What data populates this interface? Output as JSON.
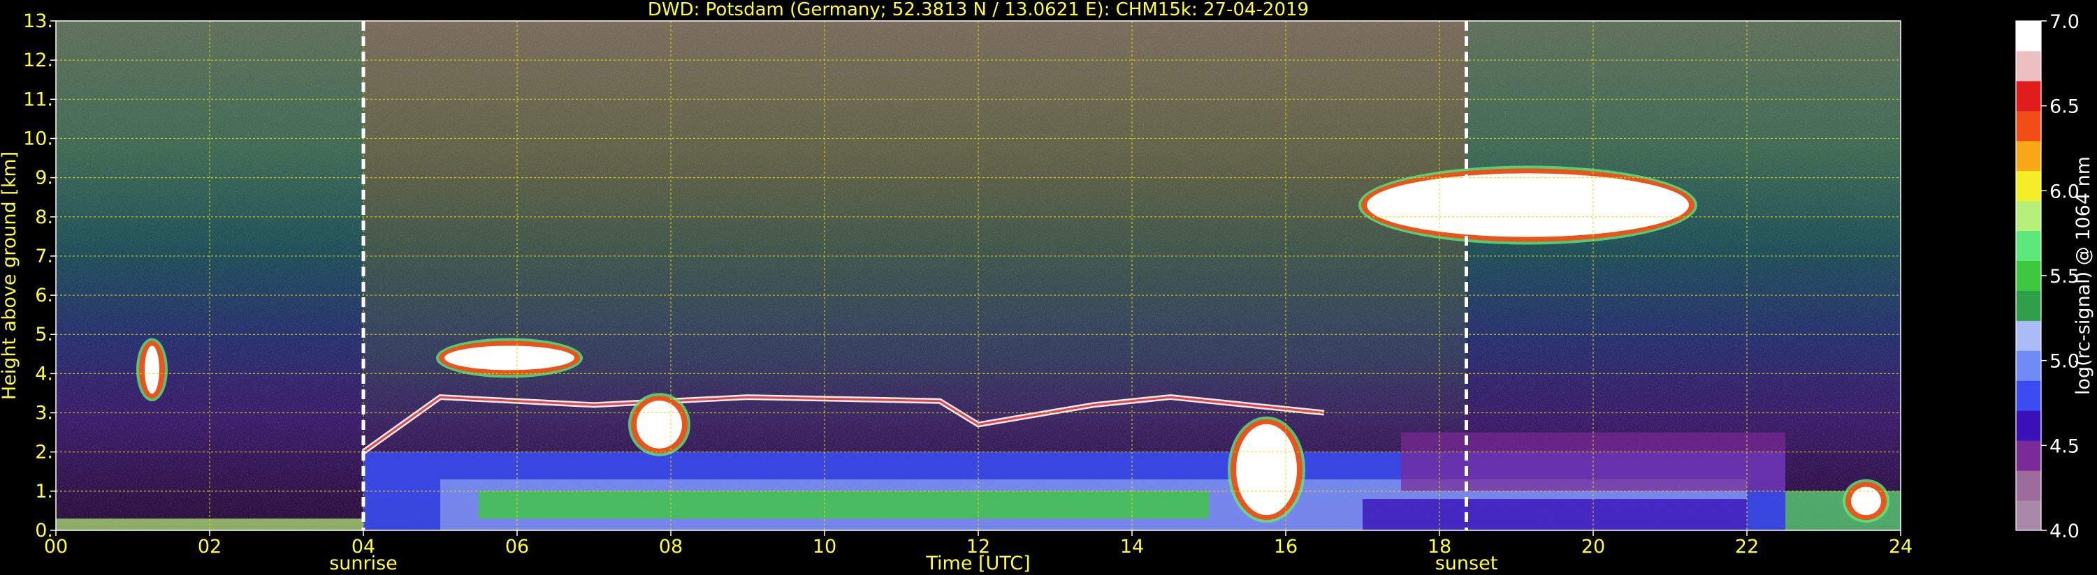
{
  "chart_data": {
    "type": "heatmap",
    "title": "DWD: Potsdam (Germany; 52.3813 N / 13.0621 E):    CHM15k: 27-04-2019",
    "xlabel": "Time [UTC]",
    "ylabel": "Height above ground [km]",
    "xlim": [
      0,
      24
    ],
    "ylim": [
      0,
      13
    ],
    "x_ticks": [
      "00",
      "02",
      "04",
      "06",
      "08",
      "10",
      "12",
      "14",
      "16",
      "18",
      "20",
      "22",
      "24"
    ],
    "y_ticks": [
      "0.",
      "1.",
      "2.",
      "3.",
      "4.",
      "5.",
      "6.",
      "7.",
      "8.",
      "9.",
      "10.",
      "11.",
      "12.",
      "13."
    ],
    "grid": true,
    "sunrise": {
      "label": "sunrise",
      "time": 4.0
    },
    "sunset": {
      "label": "sunset",
      "time": 18.35
    },
    "colorbar": {
      "label": "log(rc-signal) @ 1064 nm",
      "range": [
        4.0,
        7.0
      ],
      "tick_labels": [
        "4.0",
        "4.5",
        "5.0",
        "5.5",
        "6.0",
        "6.5",
        "7.0"
      ]
    },
    "features": [
      {
        "kind": "boundary_layer_top",
        "points": [
          [
            4.0,
            2.0
          ],
          [
            5.0,
            3.4
          ],
          [
            7.0,
            3.2
          ],
          [
            9.0,
            3.4
          ],
          [
            11.5,
            3.3
          ],
          [
            12.0,
            2.7
          ],
          [
            13.5,
            3.2
          ],
          [
            14.5,
            3.4
          ],
          [
            16.5,
            3.0
          ]
        ]
      },
      {
        "kind": "cloud",
        "t_start": 5.0,
        "t_end": 6.8,
        "h_low": 4.0,
        "h_high": 4.8
      },
      {
        "kind": "cloud",
        "t_start": 7.5,
        "t_end": 8.2,
        "h_low": 2.0,
        "h_high": 3.4
      },
      {
        "kind": "cloud",
        "t_start": 17.0,
        "t_end": 21.3,
        "h_low": 7.4,
        "h_high": 9.2
      },
      {
        "kind": "cloud",
        "t_start": 15.3,
        "t_end": 16.2,
        "h_low": 0.3,
        "h_high": 2.8
      },
      {
        "kind": "cloud",
        "t_start": 1.1,
        "t_end": 1.4,
        "h_low": 3.4,
        "h_high": 4.8
      },
      {
        "kind": "cloud",
        "t_start": 23.3,
        "t_end": 23.8,
        "h_low": 0.3,
        "h_high": 1.2
      }
    ],
    "colors": {
      "background": "#000000",
      "text": "#ffff33",
      "grid": "#dede00",
      "marker": "#ffffff"
    },
    "colormap": [
      "#a88aa8",
      "#9c6c9c",
      "#7a2a96",
      "#3a10b8",
      "#3a4cf0",
      "#6f8cf4",
      "#a9bbf5",
      "#2f9f4a",
      "#3ec83e",
      "#5ee87a",
      "#b6f07a",
      "#f6ee26",
      "#f8a816",
      "#f04e16",
      "#e01c1c",
      "#ecc0c0",
      "#ffffff"
    ]
  }
}
